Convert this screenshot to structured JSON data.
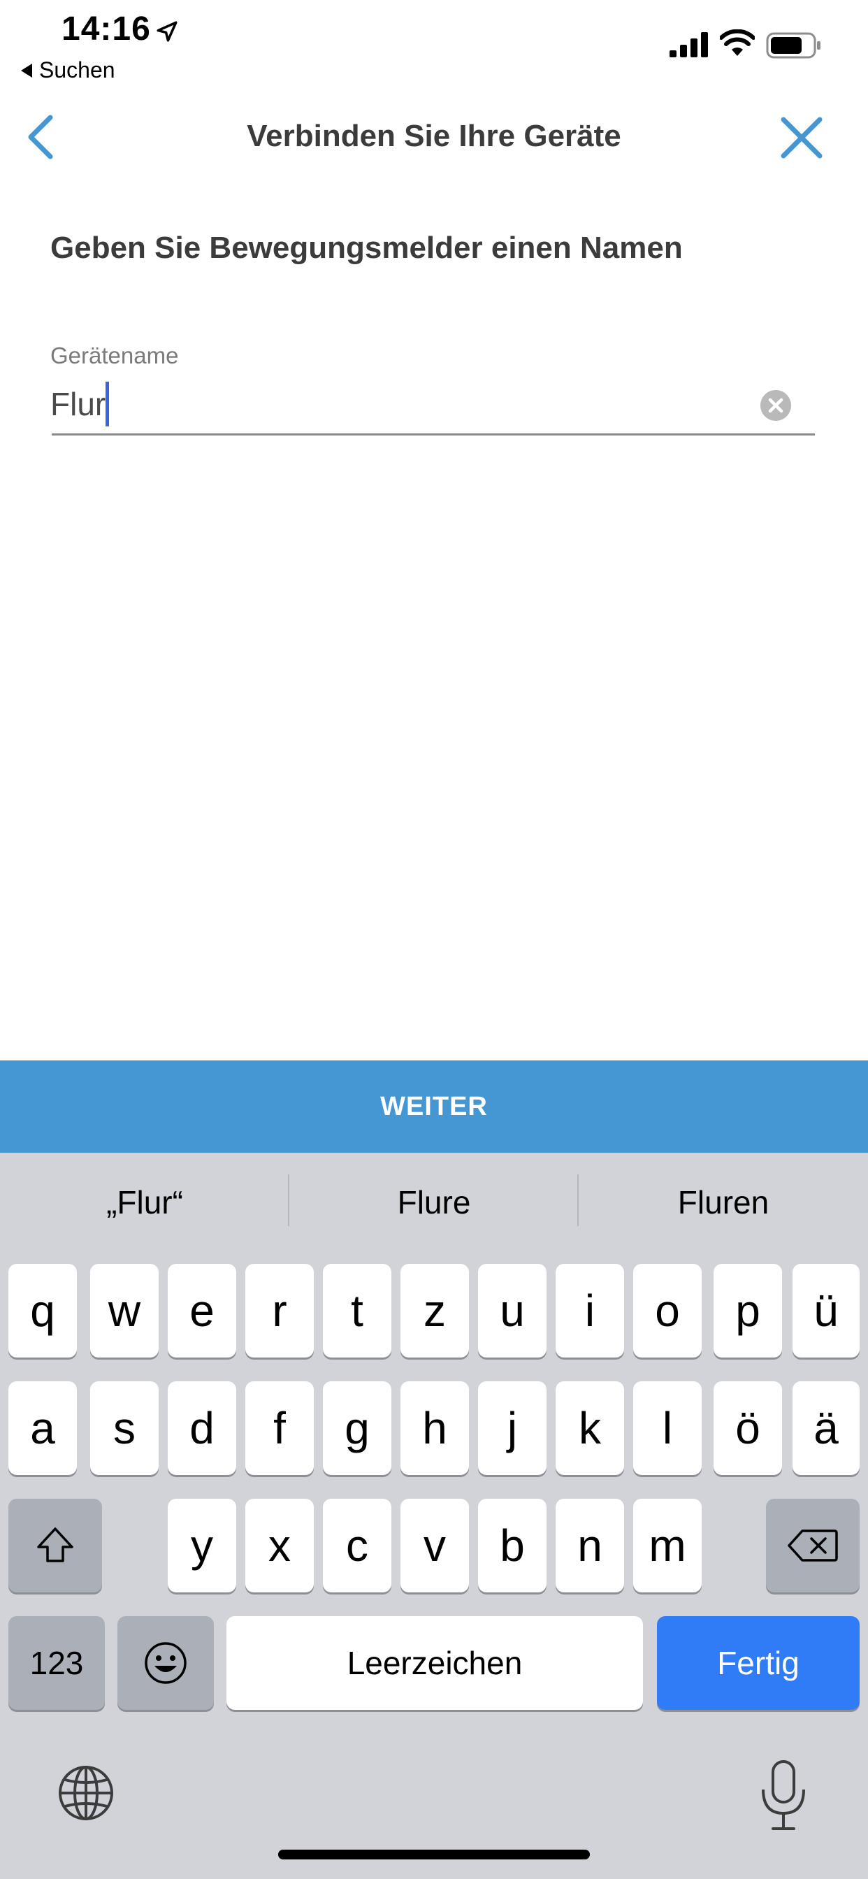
{
  "status_bar": {
    "time": "14:16",
    "back_label": "Suchen"
  },
  "nav": {
    "title": "Verbinden Sie Ihre Geräte"
  },
  "content": {
    "heading": "Geben Sie Bewegungsmelder einen Namen",
    "field_label": "Gerätename",
    "field_value": "Flur"
  },
  "action": {
    "weiter_label": "WEITER"
  },
  "keyboard": {
    "suggestions": [
      "„Flur“",
      "Flure",
      "Fluren"
    ],
    "row1": [
      "q",
      "w",
      "e",
      "r",
      "t",
      "z",
      "u",
      "i",
      "o",
      "p",
      "ü"
    ],
    "row2": [
      "a",
      "s",
      "d",
      "f",
      "g",
      "h",
      "j",
      "k",
      "l",
      "ö",
      "ä"
    ],
    "row3": [
      "y",
      "x",
      "c",
      "v",
      "b",
      "n",
      "m"
    ],
    "numbers_label": "123",
    "space_label": "Leerzeichen",
    "done_label": "Fertig"
  },
  "colors": {
    "accent": "#4597d3",
    "keyboard_bg": "#d1d3d9",
    "done_key": "#2f7cf6",
    "caret": "#3a63e0"
  }
}
